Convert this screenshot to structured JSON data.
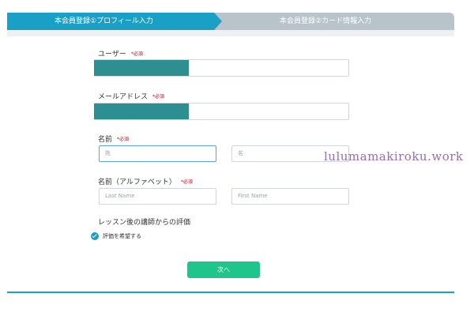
{
  "steps": {
    "step1": "本会員登録①プロフィール入力",
    "step2": "本会員登録②カード情報入力"
  },
  "form": {
    "user_label": "ユーザー",
    "email_label": "メールアドレス",
    "name_label": "名前",
    "name_last_placeholder": "姓",
    "name_first_placeholder": "名",
    "alpha_label": "名前（アルファベット）",
    "alpha_last_placeholder": "Last Name",
    "alpha_first_placeholder": "First Name",
    "required": "*必須",
    "evaluation_heading": "レッスン後の講師からの評価",
    "evaluation_option": "評価を希望する",
    "evaluation_checked": true
  },
  "next_button": "次へ",
  "watermark": "lulumamakiroku.work",
  "colors": {
    "accent": "#1a9fc6",
    "inactive_step": "#b8c4ca",
    "button": "#1fc58a",
    "required": "#d0021b",
    "redaction": "#2d8f91"
  }
}
